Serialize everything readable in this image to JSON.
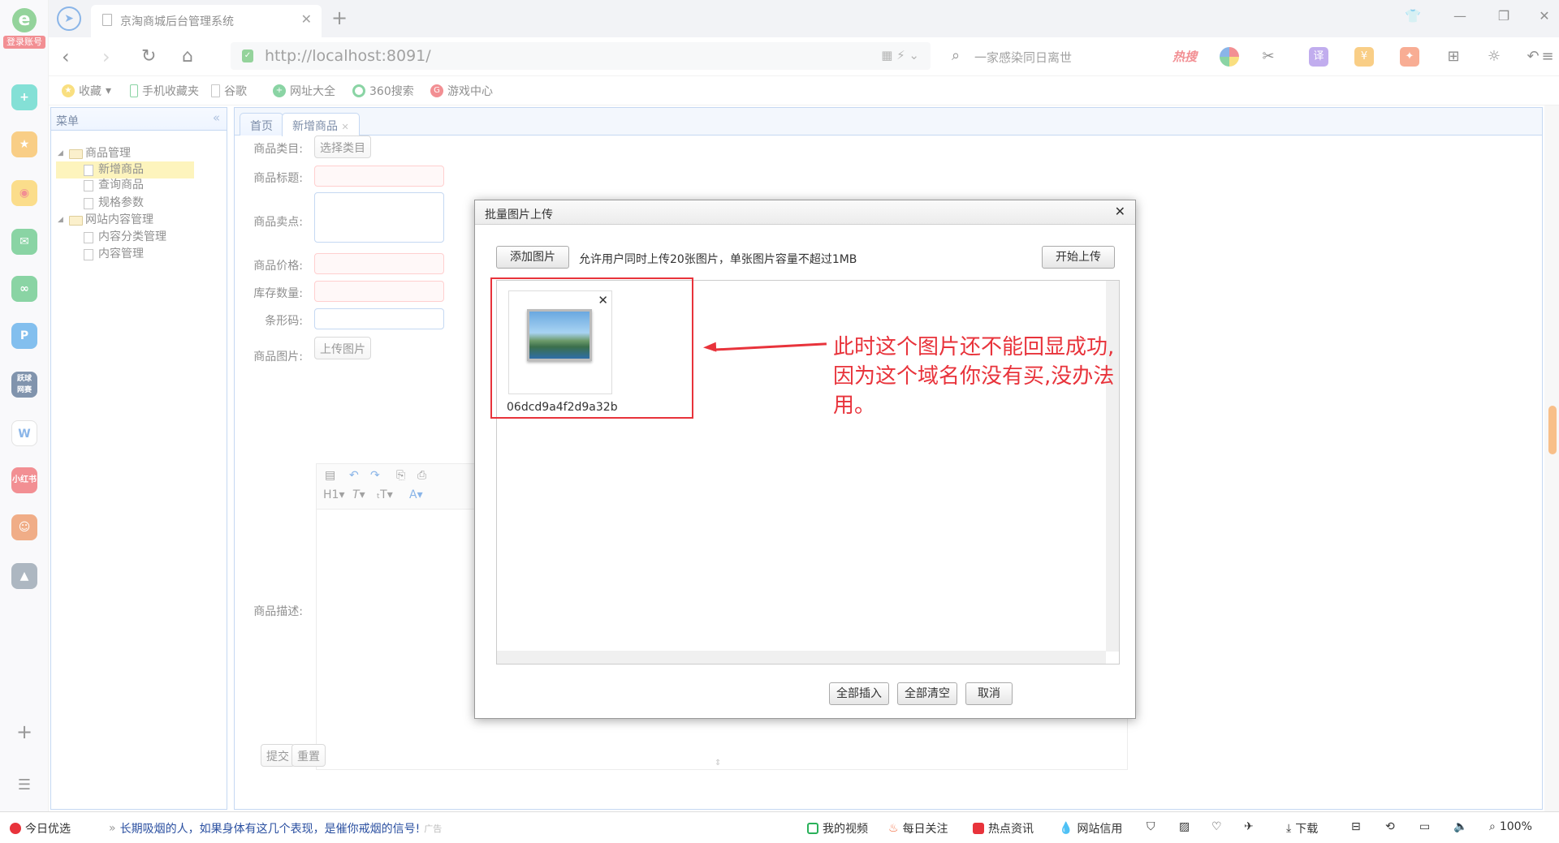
{
  "browser": {
    "tab_title": "京淘商城后台管理系统",
    "url": "http://localhost:8091/",
    "search_query": "一家感染同日离世",
    "search_hot": "热搜",
    "login_label": "登录账号",
    "bookmarks": [
      "收藏",
      "手机收藏夹",
      "谷歌",
      "网址大全",
      "360搜索",
      "游戏中心"
    ]
  },
  "menu": {
    "title": "菜单",
    "groups": [
      {
        "label": "商品管理",
        "items": [
          "新增商品",
          "查询商品",
          "规格参数"
        ]
      },
      {
        "label": "网站内容管理",
        "items": [
          "内容分类管理",
          "内容管理"
        ]
      }
    ],
    "selected": "新增商品"
  },
  "tabs": [
    "首页",
    "新增商品"
  ],
  "form": {
    "category_label": "商品类目:",
    "category_button": "选择类目",
    "title_label": "商品标题:",
    "sell_point_label": "商品卖点:",
    "price_label": "商品价格:",
    "stock_label": "库存数量:",
    "barcode_label": "条形码:",
    "image_label": "商品图片:",
    "upload_button": "上传图片",
    "desc_label": "商品描述:",
    "submit_button": "提交",
    "reset_button": "重置",
    "editor_tools": [
      "H1",
      "T",
      "A"
    ]
  },
  "dialog": {
    "title": "批量图片上传",
    "add_button": "添加图片",
    "hint": "允许用户同时上传20张图片，单张图片容量不超过1MB",
    "start_button": "开始上传",
    "file_name": "06dcd9a4f2d9a32b",
    "insert_all": "全部插入",
    "clear_all": "全部清空",
    "cancel": "取消"
  },
  "annotation": "此时这个图片还不能回显成功,因为这个域名你没有买,没办法用。",
  "statusbar": {
    "today": "今日优选",
    "news": "长期吸烟的人，如果身体有这几个表现，是催你戒烟的信号!",
    "ad": "广告",
    "my_video": "我的视频",
    "daily": "每日关注",
    "hot_news": "热点资讯",
    "credit": "网站信用",
    "download": "下载",
    "zoom": "100%"
  },
  "colors": {
    "accent": "#e8333b",
    "panel_border": "#95b8e7",
    "selected_row": "#fbec88"
  }
}
